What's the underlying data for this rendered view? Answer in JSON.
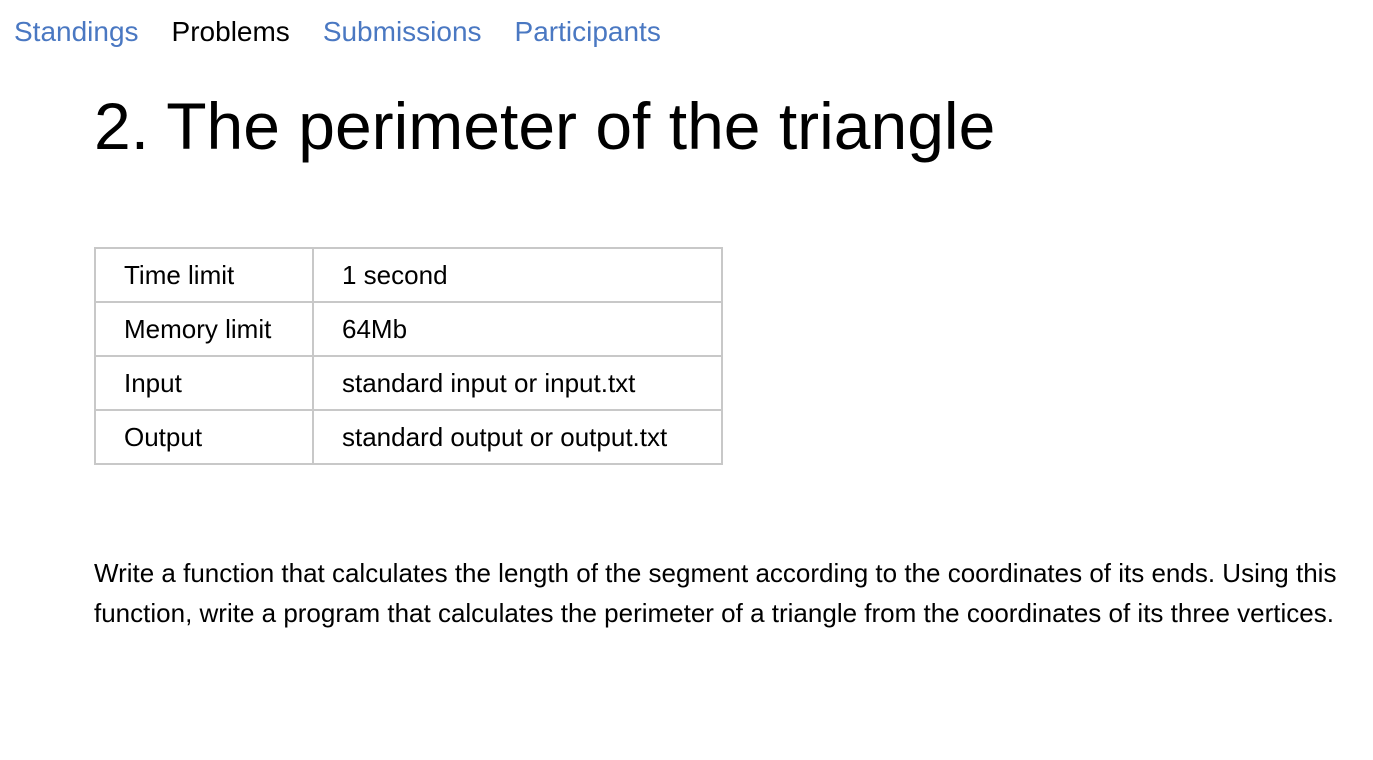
{
  "nav": {
    "items": [
      {
        "label": "Standings",
        "active": false
      },
      {
        "label": "Problems",
        "active": true
      },
      {
        "label": "Submissions",
        "active": false
      },
      {
        "label": "Participants",
        "active": false
      }
    ]
  },
  "problem": {
    "title": "2. The perimeter of the triangle",
    "limits": [
      {
        "label": "Time limit",
        "value": "1 second"
      },
      {
        "label": "Memory limit",
        "value": "64Mb"
      },
      {
        "label": "Input",
        "value": "standard input or input.txt"
      },
      {
        "label": "Output",
        "value": "standard output or output.txt"
      }
    ],
    "statement": "Write a function that calculates the length of the segment according to the coordinates of its ends. Using this function, write a program that calculates the perimeter of a triangle from the coordinates of its three vertices."
  },
  "colors": {
    "link": "#4a78c2",
    "active_link": "#000000",
    "table_border": "#c8c8c8"
  }
}
